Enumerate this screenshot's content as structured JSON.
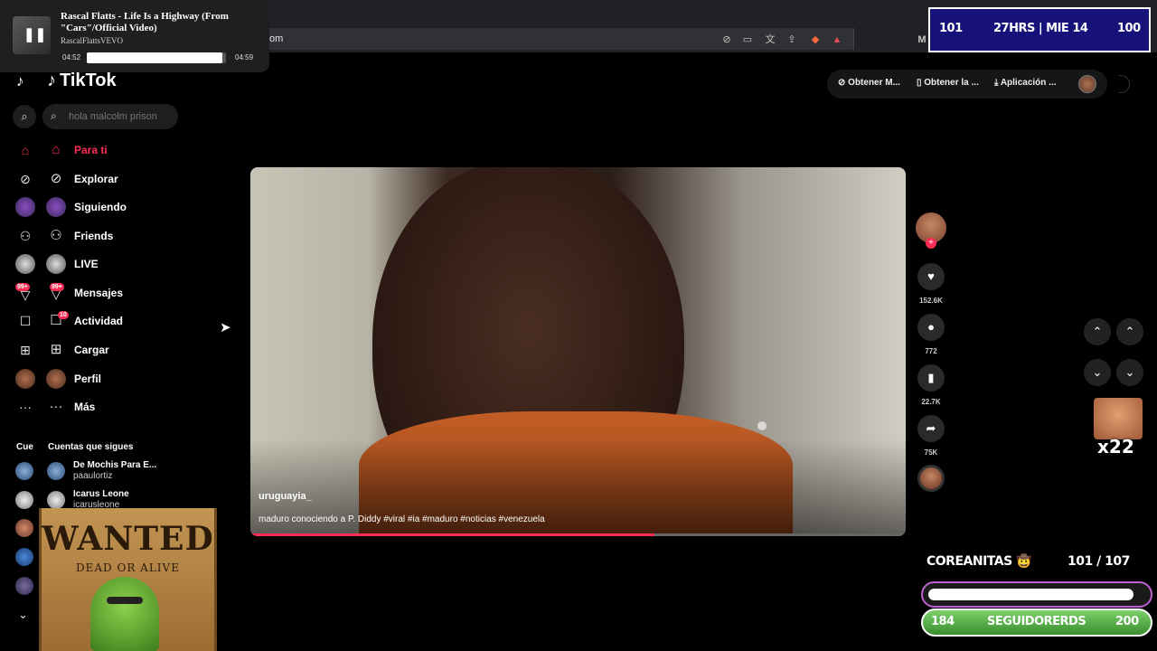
{
  "browser": {
    "url_text": "om"
  },
  "now_playing": {
    "title": "Rascal Flatts - Life Is a Highway (From \"Cars\"/Official Video)",
    "artist": "RascalFlattsVEVO",
    "current_time": "04:52",
    "total_time": "04:59",
    "progress_fraction": 0.977
  },
  "stream_top": {
    "left_num": "101",
    "center": "27HRS | MIE 14",
    "right_num": "100"
  },
  "tiktok": {
    "logo": "TikTok",
    "search_placeholder": "hola malcolm prison",
    "nav": [
      {
        "label": "Para ti",
        "icon": "home-icon",
        "active": true
      },
      {
        "label": "Explorar",
        "icon": "compass-icon"
      },
      {
        "label": "Siguiendo",
        "icon": "following-avatar-icon"
      },
      {
        "label": "Friends",
        "icon": "friends-icon"
      },
      {
        "label": "LIVE",
        "icon": "live-avatar-icon"
      },
      {
        "label": "Mensajes",
        "icon": "messages-icon",
        "badge": "99+"
      },
      {
        "label": "Actividad",
        "icon": "activity-icon",
        "badge": "10"
      },
      {
        "label": "Cargar",
        "icon": "upload-icon"
      },
      {
        "label": "Perfil",
        "icon": "profile-avatar-icon"
      },
      {
        "label": "Más",
        "icon": "more-icon"
      }
    ],
    "cue_label": "Cue",
    "following_title": "Cuentas que sigues",
    "followed_accounts": [
      {
        "name": "De Mochis Para E...",
        "handle": "paaulortiz"
      },
      {
        "name": "Icarus Leone",
        "handle": "icarusleone"
      }
    ],
    "top_buttons": [
      "Obtener M...",
      "Obtener la ...",
      "Aplicación ..."
    ],
    "video": {
      "author": "uruguayia_",
      "description": "maduro conociendo a P. Diddy #viral #ia #maduro #noticias #venezuela",
      "progress_fraction": 0.617
    },
    "actions": {
      "likes": "152.6K",
      "comments": "772",
      "saves": "22.7K",
      "shares": "75K"
    }
  },
  "wanted": {
    "title": "WANTED",
    "subtitle": "DEAD OR ALIVE"
  },
  "emote": {
    "multiplier": "x22"
  },
  "stream_goal": {
    "name": "COREANITAS 🤠",
    "count_text": "101  / 107",
    "progress_fraction": 0.944,
    "followers_label": "SEGUIDORERDS",
    "followers_current": "184",
    "followers_goal": "200"
  },
  "colors": {
    "accent": "#fe2c55",
    "stream_panel": "#17127a",
    "follow_bar": "#4fb53f"
  }
}
